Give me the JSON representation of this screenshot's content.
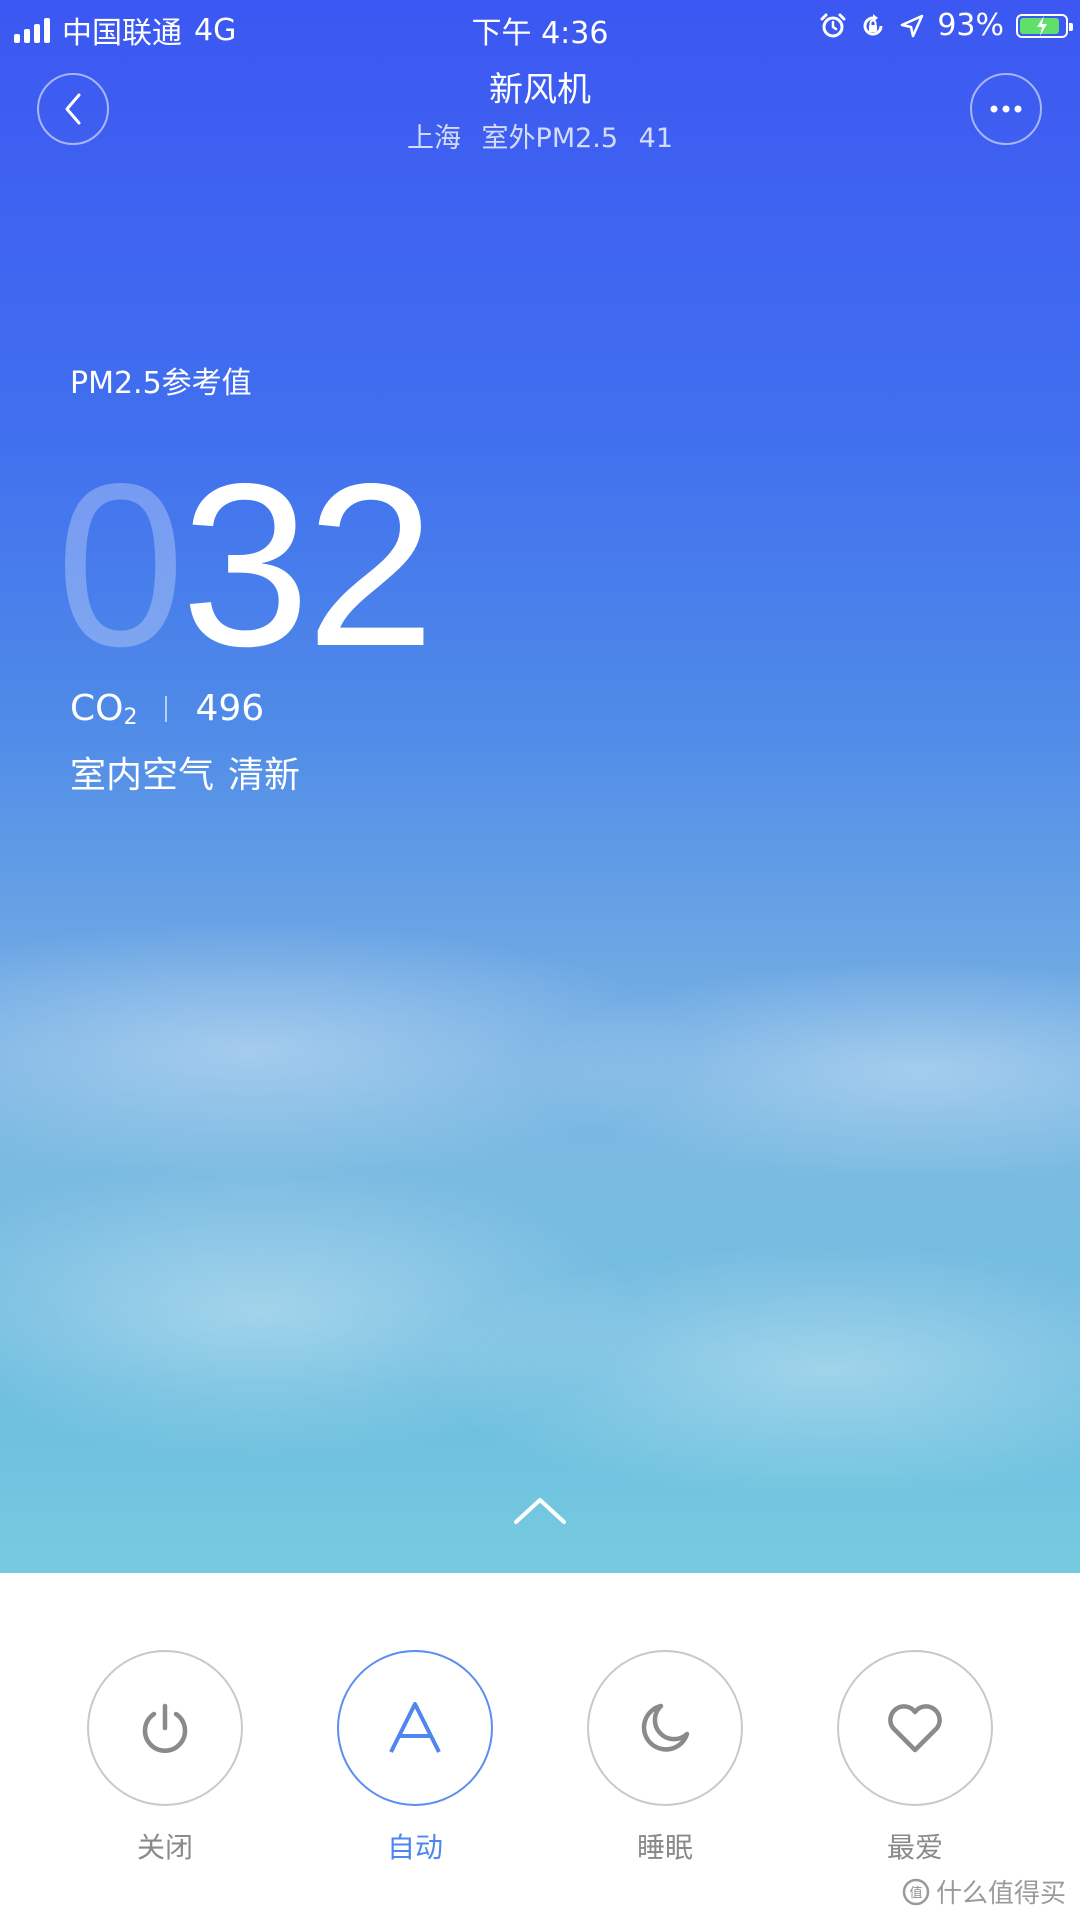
{
  "status_bar": {
    "carrier": "中国联通",
    "network": "4G",
    "time": "下午 4:36",
    "battery_percent": "93%"
  },
  "header": {
    "title": "新风机",
    "city": "上海",
    "outdoor_label": "室外PM2.5",
    "outdoor_value": "41"
  },
  "main": {
    "pm_label": "PM2.5参考值",
    "pm_leading_zero": "0",
    "pm_value": "32",
    "co2_label_main": "CO",
    "co2_label_sub": "2",
    "co2_value": "496",
    "air_label": "室内空气",
    "air_quality": "清新"
  },
  "modes": [
    {
      "label": "关闭",
      "icon": "power-icon",
      "active": false
    },
    {
      "label": "自动",
      "icon": "auto-a-icon",
      "active": true
    },
    {
      "label": "睡眠",
      "icon": "moon-icon",
      "active": false
    },
    {
      "label": "最爱",
      "icon": "heart-icon",
      "active": false
    }
  ],
  "watermark": "什么值得买",
  "colors": {
    "sky_top": "#3c57f2",
    "sky_bottom": "#76cbe0",
    "active_accent": "#4f86ee",
    "inactive_text": "#8a8a8a"
  }
}
